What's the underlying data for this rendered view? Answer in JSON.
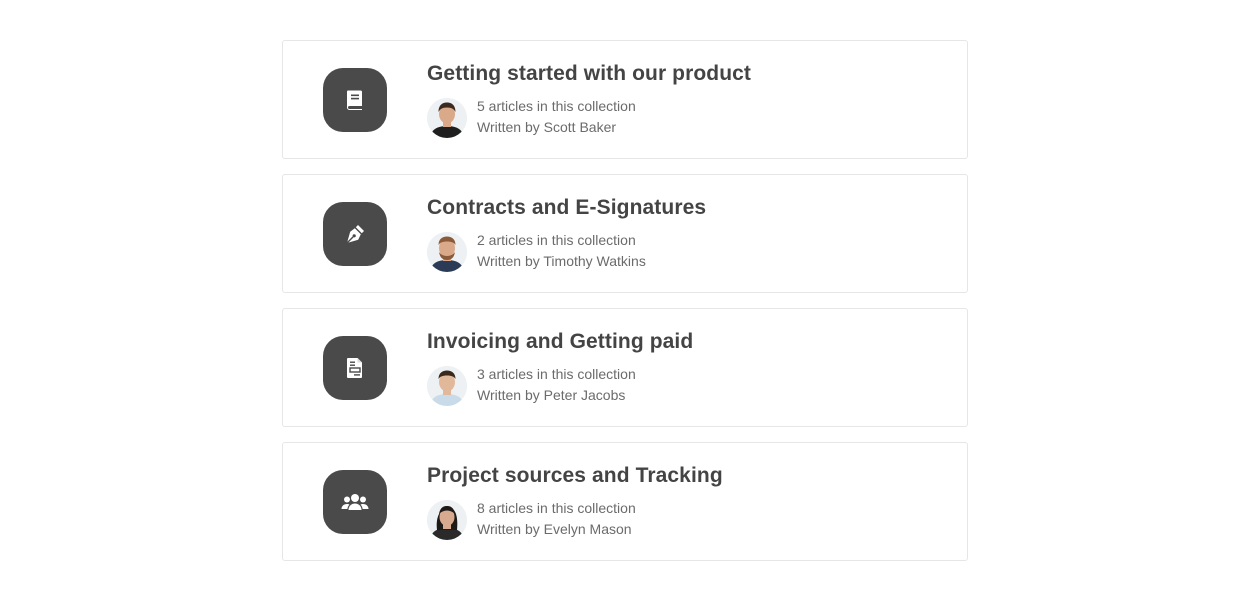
{
  "collections": [
    {
      "title": "Getting started with our product",
      "articles": "5 articles in this collection",
      "author": "Written by Scott Baker",
      "icon": "book-icon",
      "avatar": {
        "skin": "#d9a98a",
        "hair": "#3b2a20",
        "shirt": "#1f1f1f"
      }
    },
    {
      "title": "Contracts and E-Signatures",
      "articles": "2 articles in this collection",
      "author": "Written by Timothy Watkins",
      "icon": "pen-nib-icon",
      "avatar": {
        "skin": "#d9a98a",
        "hair": "#8a5a3a",
        "shirt": "#2b3a55"
      }
    },
    {
      "title": "Invoicing and Getting paid",
      "articles": "3 articles in this collection",
      "author": "Written by Peter Jacobs",
      "icon": "invoice-icon",
      "avatar": {
        "skin": "#e2b89a",
        "hair": "#3a2a1e",
        "shirt": "#c9dbe8"
      }
    },
    {
      "title": "Project sources and Tracking",
      "articles": "8 articles in this collection",
      "author": "Written by Evelyn Mason",
      "icon": "users-icon",
      "avatar": {
        "skin": "#d7a98e",
        "hair": "#1e1a18",
        "shirt": "#2a2a2a"
      }
    }
  ],
  "colors": {
    "icon_background": "#4a4a4a",
    "title": "#444444",
    "meta": "#6b6b6b",
    "card_border": "#e6e6e6"
  }
}
